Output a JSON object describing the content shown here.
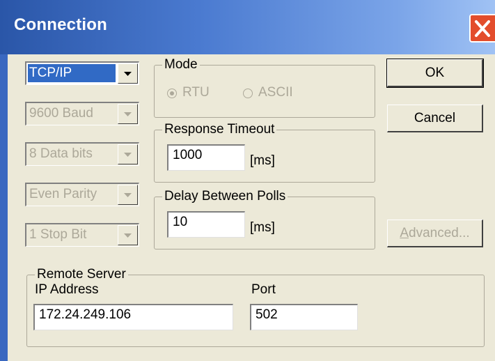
{
  "window": {
    "title": "Connection",
    "close_icon": "close-x-icon"
  },
  "left_column": {
    "protocol": "TCP/IP",
    "baud": "9600 Baud",
    "data_bits": "8 Data bits",
    "parity": "Even Parity",
    "stop_bits": "1 Stop Bit"
  },
  "mode": {
    "legend": "Mode",
    "options": [
      "RTU",
      "ASCII"
    ],
    "selected": "RTU"
  },
  "response_timeout": {
    "legend": "Response Timeout",
    "value": "1000",
    "unit": "[ms]"
  },
  "delay_between_polls": {
    "legend": "Delay Between Polls",
    "value": "10",
    "unit": "[ms]"
  },
  "buttons": {
    "ok": "OK",
    "cancel": "Cancel",
    "advanced_prefix": "A",
    "advanced_rest": "dvanced..."
  },
  "remote_server": {
    "legend": "Remote Server",
    "ip_label": "IP Address",
    "ip_value": "172.24.249.106",
    "port_label": "Port",
    "port_value": "502"
  },
  "colors": {
    "title_bar": "#2a56a8",
    "selection": "#316ac5",
    "disabled": "#aca899",
    "face": "#ece9d8"
  }
}
